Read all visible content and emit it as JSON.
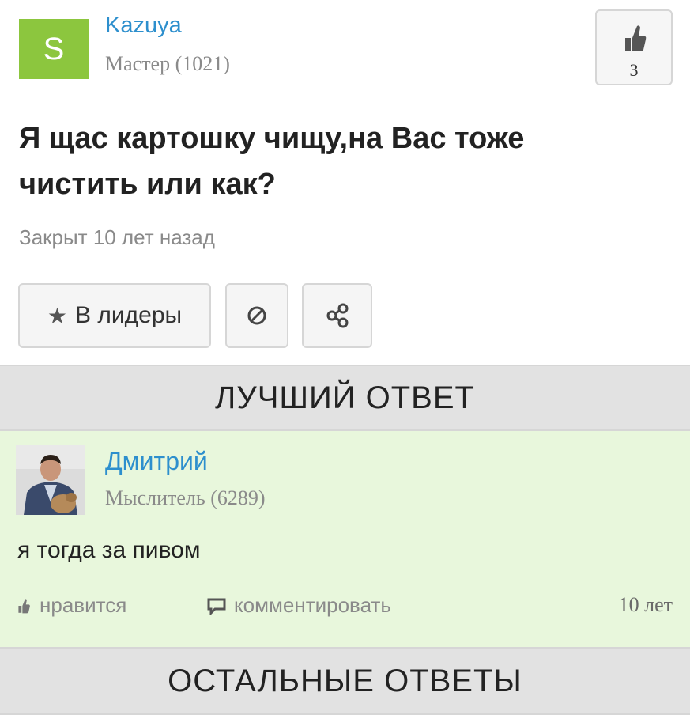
{
  "question": {
    "author": {
      "initial": "S",
      "name": "Kazuya",
      "rank": "Мастер (1021)",
      "avatar_color": "#8cc63e"
    },
    "votes": {
      "count": "3",
      "icon": "thumbs-up-icon"
    },
    "title": "Я щас картошку чищу,на Вас тоже чистить или как?",
    "status": "Закрыт 10 лет назад",
    "actions": {
      "leaders_label": "В лидеры",
      "leaders_icon": "star-icon",
      "block_icon": "block-icon",
      "share_icon": "share-icon"
    }
  },
  "best_answer": {
    "header": "ЛУЧШИЙ ОТВЕТ",
    "author": {
      "name": "Дмитрий",
      "rank": "Мыслитель (6289)"
    },
    "text": "я тогда за пивом",
    "like_label": "нравится",
    "comment_label": "комментировать",
    "time": "10 лет"
  },
  "others_header": "ОСТАЛЬНЫЕ ОТВЕТЫ",
  "colors": {
    "link": "#2d8fcd",
    "answer_bg": "#e8f7dc",
    "header_bg": "#e2e2e2"
  }
}
